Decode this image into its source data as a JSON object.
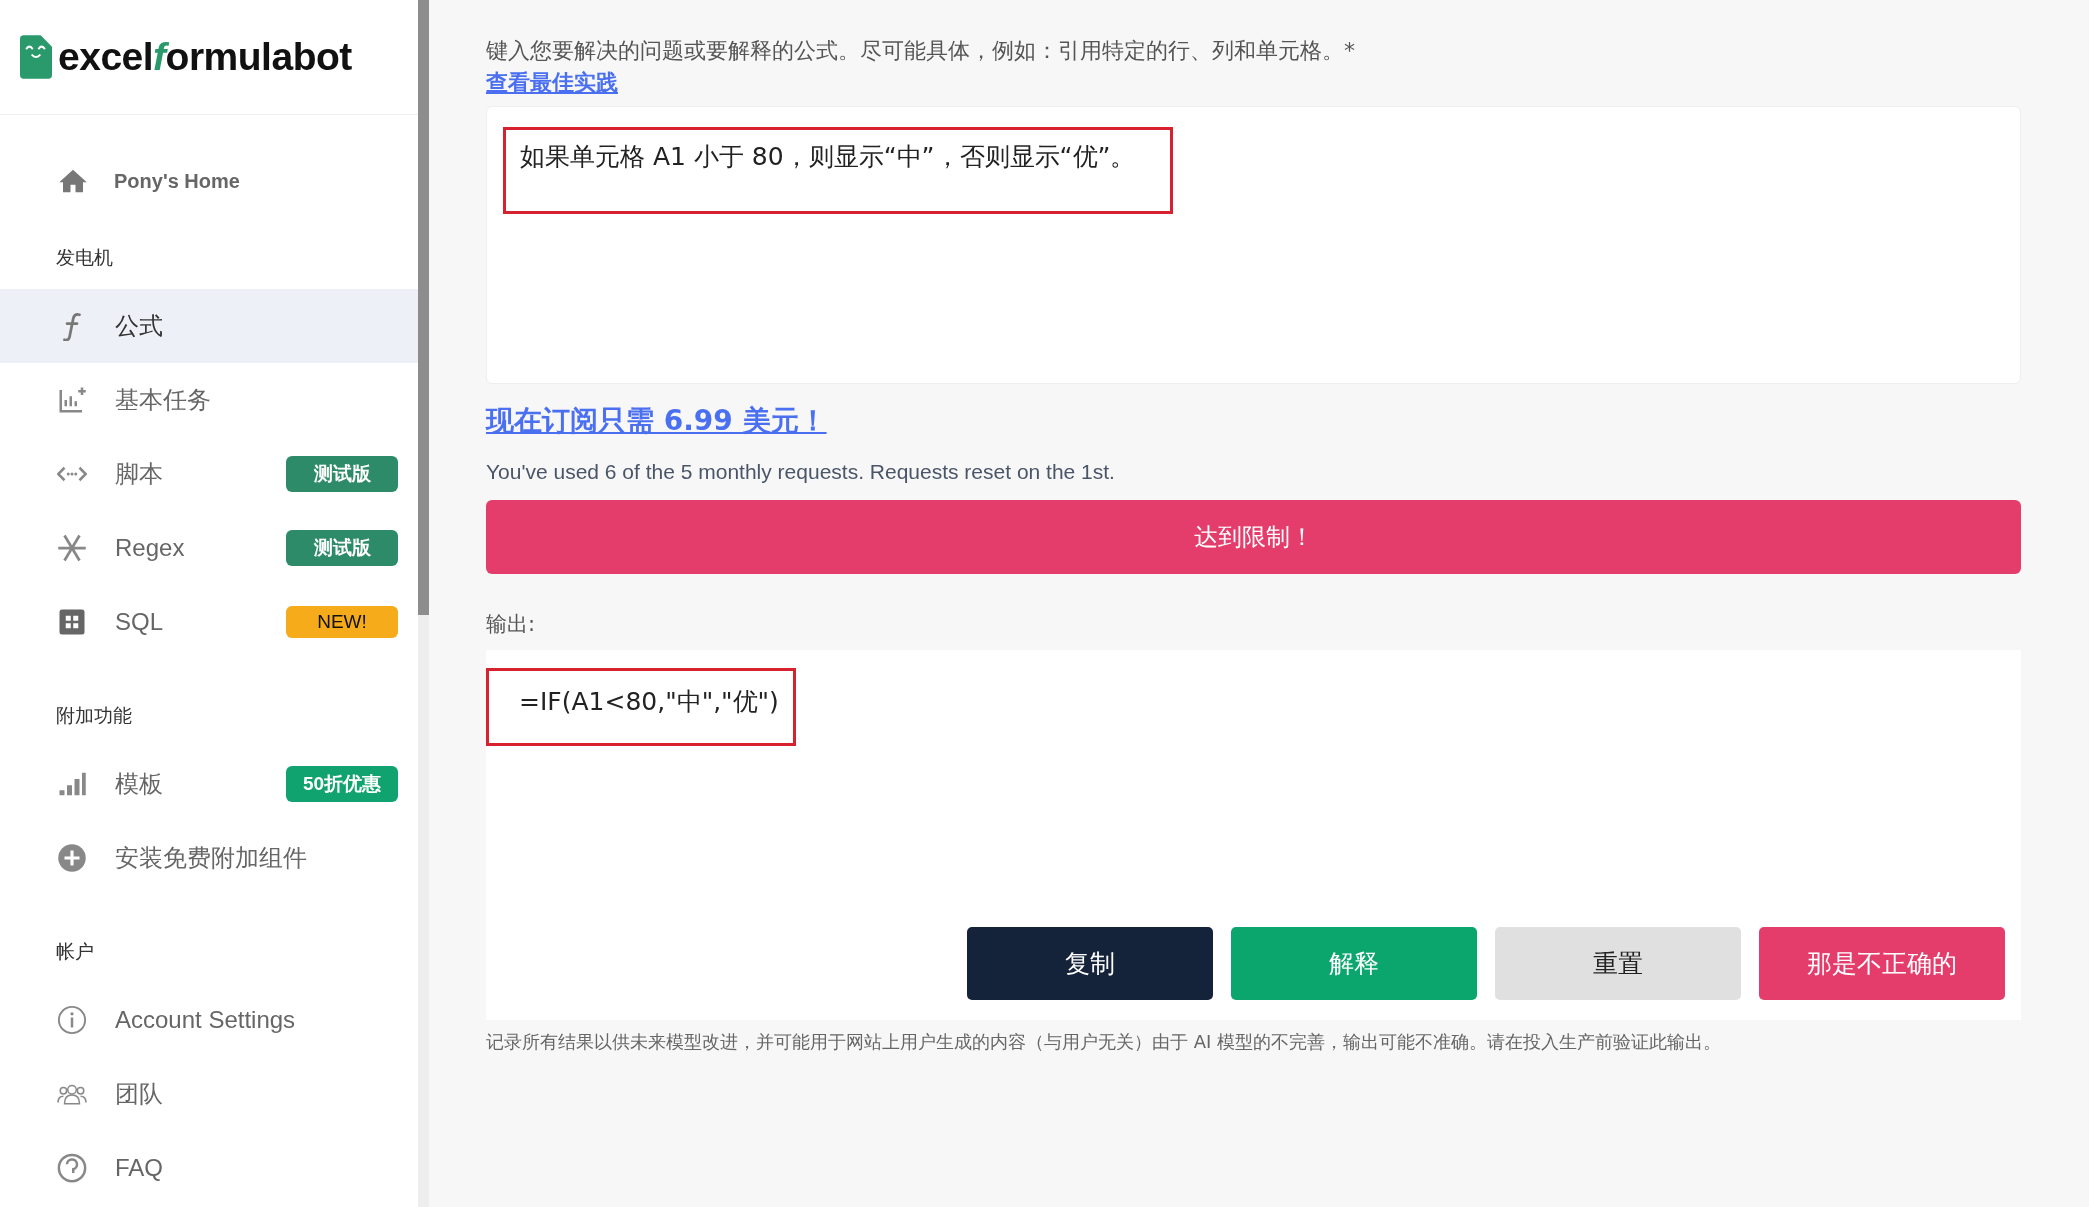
{
  "sidebar": {
    "logo": {
      "part1": "excel",
      "part2": "f",
      "part3": "ormulabot"
    },
    "home": {
      "label": "Pony's Home",
      "kind": "home"
    },
    "sections": [
      {
        "title": "发电机",
        "items": [
          {
            "label": "公式",
            "kind": "formula",
            "selected": true
          },
          {
            "label": "基本任务",
            "kind": "tasks",
            "selected": false
          },
          {
            "label": "脚本",
            "kind": "script",
            "selected": false,
            "badge": "测试版",
            "color": "#2e8b6a"
          },
          {
            "label": "Regex",
            "kind": "regex",
            "selected": false,
            "badge": "测试版",
            "color": "#2e8b6a"
          },
          {
            "label": "SQL",
            "kind": "sql",
            "selected": false,
            "badge": "NEW!",
            "color": "#f5ab1a"
          }
        ]
      },
      {
        "title": "附加功能",
        "items": [
          {
            "label": "模板",
            "kind": "bars",
            "selected": false,
            "badge": "50折优惠",
            "color": "#10a36f"
          },
          {
            "label": "安装免费附加组件",
            "kind": "plus",
            "selected": false
          }
        ]
      },
      {
        "title": "帐户",
        "items": [
          {
            "label": "Account Settings",
            "kind": "info",
            "selected": false
          },
          {
            "label": "团队",
            "kind": "team",
            "selected": false
          },
          {
            "label": "FAQ",
            "kind": "faq",
            "selected": false
          }
        ]
      }
    ]
  },
  "main": {
    "prompt_label": "键入您要解决的问题或要解释的公式。尽可能具体，例如：引用特定的行、列和单元格。*",
    "best_practice_link": "查看最佳实践",
    "input_value": "如果单元格 A1 小于 80，则显示“中”，否则显示“优”。",
    "subscribe_link": "现在订阅只需 6.99 美元！",
    "usage_text": "You've used 6 of the 5 monthly requests. Requests reset on the 1st.",
    "limit_button": "达到限制！",
    "output_label": "输出:",
    "output_value": "=IF(A1<80,\"中\",\"优\")",
    "buttons": [
      {
        "label": "复制",
        "kind": "dark"
      },
      {
        "label": "解释",
        "kind": "green"
      },
      {
        "label": "重置",
        "kind": "grey"
      },
      {
        "label": "那是不正确的",
        "kind": "red"
      }
    ],
    "disclaimer": "记录所有结果以供未来模型改进，并可能用于网站上用户生成的内容（与用户无关）由于 AI 模型的不完善，输出可能不准确。请在投入生产前验证此输出。"
  }
}
